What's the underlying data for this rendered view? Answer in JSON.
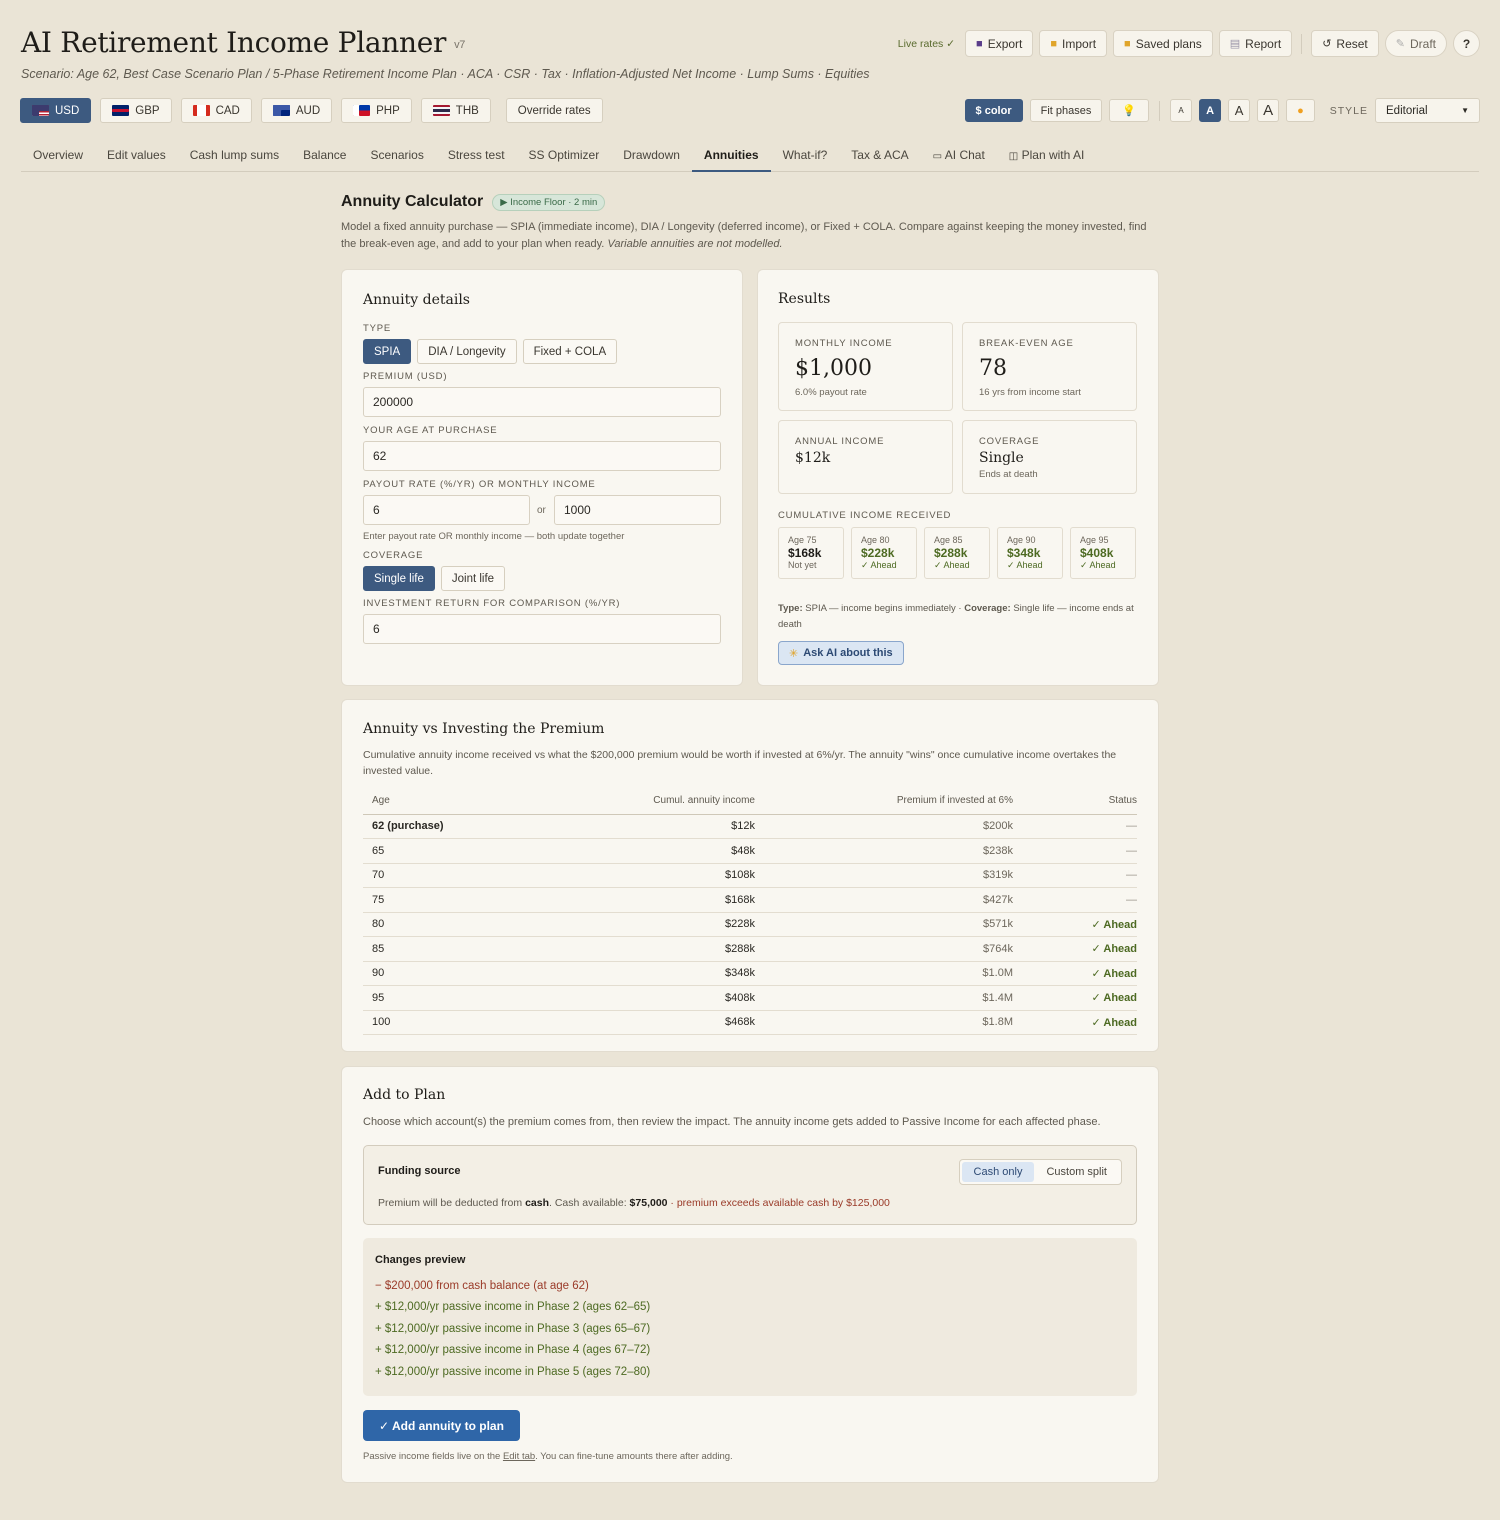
{
  "header": {
    "title": "AI Retirement Income Planner",
    "version": "v7",
    "scenario": "Scenario: Age 62, Best Case Scenario Plan / 5-Phase Retirement Income Plan · ACA · CSR · Tax · Inflation-Adjusted Net Income · Lump Sums · Equities",
    "live_rates": "Live rates ✓",
    "actions": {
      "export": "Export",
      "import": "Import",
      "saved_plans": "Saved plans",
      "report": "Report",
      "reset": "Reset",
      "draft": "Draft",
      "help": "?"
    }
  },
  "currencies": [
    {
      "code": "USD",
      "active": true
    },
    {
      "code": "GBP",
      "active": false
    },
    {
      "code": "CAD",
      "active": false
    },
    {
      "code": "AUD",
      "active": false
    },
    {
      "code": "PHP",
      "active": false
    },
    {
      "code": "THB",
      "active": false
    }
  ],
  "override_rates": "Override rates",
  "toolbar": {
    "color_btn": "$ color",
    "fit_phases": "Fit phases",
    "font_sizes": [
      "A",
      "A",
      "A",
      "A"
    ],
    "style_label": "STYLE",
    "style_value": "Editorial"
  },
  "tabs": [
    "Overview",
    "Edit values",
    "Cash lump sums",
    "Balance",
    "Scenarios",
    "Stress test",
    "SS Optimizer",
    "Drawdown",
    "Annuities",
    "What-if?",
    "Tax & ACA",
    "AI Chat",
    "Plan with AI"
  ],
  "active_tab": "Annuities",
  "calculator": {
    "title": "Annuity Calculator",
    "chip": "▶ Income Floor · 2 min",
    "desc": "Model a fixed annuity purchase — SPIA (immediate income), DIA / Longevity (deferred income), or Fixed + COLA. Compare against keeping the money invested, find the break-even age, and add to your plan when ready.",
    "desc_em": "Variable annuities are not modelled."
  },
  "details": {
    "title": "Annuity details",
    "type_label": "TYPE",
    "types": [
      "SPIA",
      "DIA / Longevity",
      "Fixed + COLA"
    ],
    "premium_label": "PREMIUM (USD)",
    "premium_value": "200000",
    "age_label": "YOUR AGE AT PURCHASE",
    "age_value": "62",
    "payout_label": "PAYOUT RATE (%/YR) OR MONTHLY INCOME",
    "payout_rate": "6",
    "or": "or",
    "monthly_income": "1000",
    "payout_hint": "Enter payout rate OR monthly income — both update together",
    "coverage_label": "COVERAGE",
    "coverage_options": [
      "Single life",
      "Joint life"
    ],
    "return_label": "INVESTMENT RETURN FOR COMPARISON (%/YR)",
    "return_value": "6"
  },
  "results": {
    "title": "Results",
    "monthly_label": "MONTHLY INCOME",
    "monthly_value": "$1,000",
    "monthly_sub": "6.0% payout rate",
    "breakeven_label": "BREAK-EVEN AGE",
    "breakeven_value": "78",
    "breakeven_sub": "16 yrs from income start",
    "annual_label": "ANNUAL INCOME",
    "annual_value": "$12k",
    "coverage_label": "COVERAGE",
    "coverage_value": "Single",
    "coverage_sub": "Ends at death",
    "cumulative_label": "CUMULATIVE INCOME RECEIVED",
    "cumulative": [
      {
        "age": "Age 75",
        "value": "$168k",
        "status": "Not yet"
      },
      {
        "age": "Age 80",
        "value": "$228k",
        "status": "✓ Ahead"
      },
      {
        "age": "Age 85",
        "value": "$288k",
        "status": "✓ Ahead"
      },
      {
        "age": "Age 90",
        "value": "$348k",
        "status": "✓ Ahead"
      },
      {
        "age": "Age 95",
        "value": "$408k",
        "status": "✓ Ahead"
      }
    ],
    "note_type_label": "Type:",
    "note_type": "SPIA — income begins immediately",
    "note_cov_label": "Coverage:",
    "note_cov": "Single life — income ends at death",
    "ask_ai": "Ask AI about this"
  },
  "comparison": {
    "title": "Annuity vs Investing the Premium",
    "desc": "Cumulative annuity income received vs what the $200,000 premium would be worth if invested at 6%/yr. The annuity \"wins\" once cumulative income overtakes the invested value.",
    "headers": [
      "Age",
      "Cumul. annuity income",
      "Premium if invested at 6%",
      "Status"
    ],
    "rows": [
      [
        "62 (purchase)",
        "$12k",
        "$200k",
        "—"
      ],
      [
        "65",
        "$48k",
        "$238k",
        "—"
      ],
      [
        "70",
        "$108k",
        "$319k",
        "—"
      ],
      [
        "75",
        "$168k",
        "$427k",
        "—"
      ],
      [
        "80",
        "$228k",
        "$571k",
        "✓ Ahead"
      ],
      [
        "85",
        "$288k",
        "$764k",
        "✓ Ahead"
      ],
      [
        "90",
        "$348k",
        "$1.0M",
        "✓ Ahead"
      ],
      [
        "95",
        "$408k",
        "$1.4M",
        "✓ Ahead"
      ],
      [
        "100",
        "$468k",
        "$1.8M",
        "✓ Ahead"
      ]
    ]
  },
  "add_plan": {
    "title": "Add to Plan",
    "desc": "Choose which account(s) the premium comes from, then review the impact. The annuity income gets added to Passive Income for each affected phase.",
    "funding_label": "Funding source",
    "funding_options": [
      "Cash only",
      "Custom split"
    ],
    "funding_note_a": "Premium will be deducted from ",
    "funding_note_b": "cash",
    "funding_note_c": ". Cash available: ",
    "funding_cash": "$75,000",
    "funding_warn": " · premium exceeds available cash by $125,000",
    "preview_title": "Changes preview",
    "preview": [
      "− $200,000 from cash balance (at age 62)",
      "+ $12,000/yr passive income in Phase 2 (ages 62–65)",
      "+ $12,000/yr passive income in Phase 3 (ages 65–67)",
      "+ $12,000/yr passive income in Phase 4 (ages 67–72)",
      "+ $12,000/yr passive income in Phase 5 (ages 72–80)"
    ],
    "add_btn": "✓ Add annuity to plan",
    "footer_a": "Passive income fields live on the ",
    "footer_link": "Edit tab",
    "footer_b": ". You can fine-tune amounts there after adding."
  },
  "colors": {
    "accent": "#3d5a80",
    "primary": "#2f66a8",
    "positive": "#4d6a22",
    "negative": "#9a3a28",
    "background": "#eae4d6"
  }
}
